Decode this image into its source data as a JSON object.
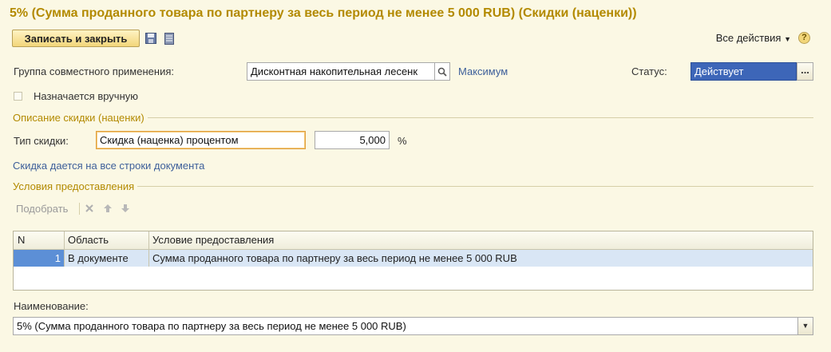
{
  "window": {
    "title": "5% (Сумма проданного товара по партнеру за весь период не менее 5 000 RUB) (Скидки (наценки))"
  },
  "toolbar": {
    "save_close_label": "Записать и закрыть",
    "save_icon": "floppy-disk-icon",
    "doc_icon": "document-list-icon",
    "all_actions_label": "Все действия",
    "help_label": "?"
  },
  "form": {
    "group_label": "Группа совместного применения:",
    "group_value": "Дисконтная накопительная лесенк",
    "group_link": "Максимум",
    "status_label": "Статус:",
    "status_value": "Действует",
    "status_button": "...",
    "manual_label": "Назначается вручную",
    "manual_checked": false
  },
  "discount": {
    "section_title": "Описание скидки (наценки)",
    "type_label": "Тип скидки:",
    "type_value": "Скидка (наценка) процентом",
    "percent_value": "5,000",
    "percent_unit": "%",
    "rows_link": "Скидка дается на все строки документа"
  },
  "conditions": {
    "section_title": "Условия предоставления",
    "pick_label": "Подобрать",
    "columns": [
      "N",
      "Область",
      "Условие предоставления"
    ],
    "rows": [
      {
        "n": "1",
        "area": "В документе",
        "condition": "Сумма проданного товара по партнеру за весь период не менее  5 000 RUB"
      }
    ]
  },
  "name": {
    "label": "Наименование:",
    "value": "5% (Сумма проданного товара по партнеру за весь период не менее 5 000 RUB)"
  },
  "colors": {
    "background": "#fbf8e4",
    "title": "#b38a00",
    "link": "#3d5f9a",
    "status_bg": "#3d66b8",
    "selected_row": "#d9e6f5"
  }
}
